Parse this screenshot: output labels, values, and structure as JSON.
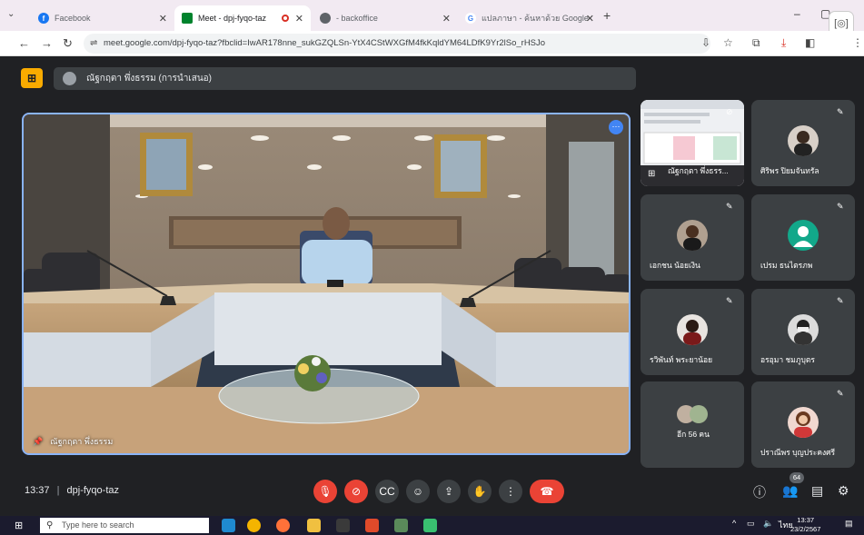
{
  "browser": {
    "tabs": [
      {
        "title": "Facebook",
        "icon": "facebook-icon"
      },
      {
        "title": "Meet - dpj-fyqo-taz",
        "icon": "google-meet-icon"
      },
      {
        "title": "- backoffice",
        "icon": "globe-icon"
      },
      {
        "title": "แปลภาษา - ค้นหาด้วย Google",
        "icon": "google-icon"
      }
    ],
    "url": "meet.google.com/dpj-fyqo-taz?fbclid=IwAR178nne_sukGZQLSn-YtX4CStWXGfM4fkKqldYM64LDfK9Yr2lSo_rHSJo"
  },
  "meet": {
    "presenter_label": "ณัฐกฤตา พึ่งธรรม (การนำเสนอ)",
    "main_speaker_name": "ณัฐกฤตา พึ่งธรรม",
    "participants": [
      {
        "name": "ณัฐกฤตา พึ่งธรร...",
        "type": "screen"
      },
      {
        "name": "ศิริพร ปิยมจันทรัล",
        "type": "photo"
      },
      {
        "name": "เอกชน น้อยเงิน",
        "type": "photo"
      },
      {
        "name": "เปรม ธนไตรภพ",
        "type": "default"
      },
      {
        "name": "รวิพันท์ พระยาน้อย",
        "type": "photo"
      },
      {
        "name": "อรอุมา ชมภูบุตร",
        "type": "photo"
      },
      {
        "name": "อีก 56 คน",
        "type": "group"
      },
      {
        "name": "ปราณีพร บุญประคงศรี",
        "type": "photo"
      }
    ],
    "time": "13:37",
    "meeting_code": "dpj-fyqo-taz",
    "participant_count": "64"
  },
  "taskbar": {
    "search_placeholder": "Type here to search",
    "language": "ไทย",
    "time": "13:37",
    "date": "23/2/2567"
  }
}
